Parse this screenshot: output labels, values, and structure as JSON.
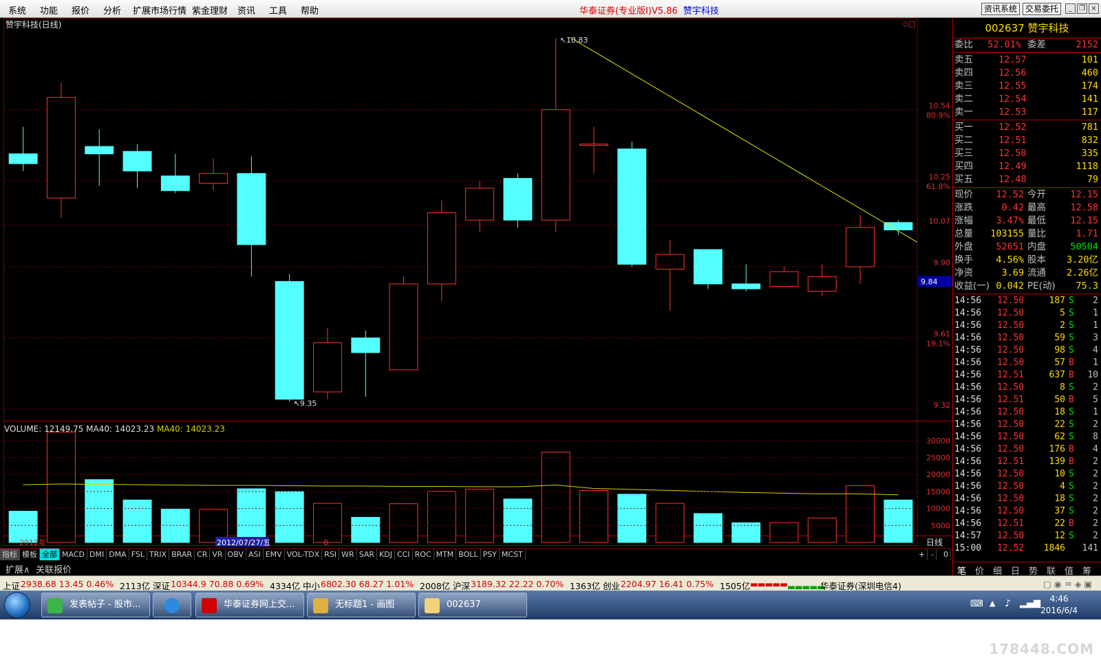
{
  "menu": [
    "系统",
    "功能",
    "报价",
    "分析",
    "扩展市场行情",
    "紫金理财",
    "资讯",
    "工具",
    "帮助"
  ],
  "app_title": "华泰证券(专业版Ⅰ)V5.86",
  "stock_title": "赞宇科技",
  "top_buttons": [
    "资讯系统",
    "交易委托"
  ],
  "window_buttons": [
    "_",
    "❐",
    "×"
  ],
  "chart_title": "赞宇科技(日线)",
  "price_scale": {
    "ticks": [
      "10.54",
      "10.25",
      "10.07",
      "9.90",
      "9.61",
      "9.32"
    ],
    "pcts": [
      "80.9%",
      "61.8%",
      "19.1%"
    ],
    "marker": "9.84"
  },
  "annotations": {
    "high": "10.83",
    "low": "9.35"
  },
  "volume_label": {
    "prefix": "VOLUME: 12149.75  MA40: 14023.23",
    "ma": "MA40: 14023.23"
  },
  "volume_scale": [
    "30000",
    "25000",
    "20000",
    "15000",
    "10000",
    "5000"
  ],
  "date_bar": {
    "year": "2012年",
    "date": "2012/07/27/五",
    "tick": "8",
    "period": "日线"
  },
  "indicator_tabs": [
    "指标",
    "模板",
    "全部",
    "MACD",
    "DMI",
    "DMA",
    "FSL",
    "TRIX",
    "BRAR",
    "CR",
    "VR",
    "OBV",
    "ASI",
    "EMV",
    "VOL-TDX",
    "RSI",
    "WR",
    "SAR",
    "KDJ",
    "CCI",
    "ROC",
    "MTM",
    "BOLL",
    "PSY",
    "MCST"
  ],
  "indicator_right": [
    "+",
    "-",
    "0"
  ],
  "ext_tabs": [
    "扩展∧",
    "关联报价"
  ],
  "colors": {
    "up": "#ff3232",
    "down": "#54ffff",
    "ma": "#d4d400",
    "trend": "#e8e800",
    "grid": "#7a0000",
    "accent": "#ffde00"
  },
  "chart_data": {
    "type": "candlestick",
    "title": "赞宇科技(日线)",
    "ylim": [
      9.32,
      10.83
    ],
    "candles": [
      {
        "o": 10.36,
        "c": 10.32,
        "h": 10.47,
        "l": 10.29,
        "v": 9200
      },
      {
        "o": 10.18,
        "c": 10.59,
        "h": 10.65,
        "l": 10.1,
        "v": 32500
      },
      {
        "o": 10.39,
        "c": 10.36,
        "h": 10.46,
        "l": 10.23,
        "v": 18500
      },
      {
        "o": 10.37,
        "c": 10.29,
        "h": 10.4,
        "l": 10.22,
        "v": 12500
      },
      {
        "o": 10.27,
        "c": 10.21,
        "h": 10.36,
        "l": 10.2,
        "v": 9800
      },
      {
        "o": 10.24,
        "c": 10.28,
        "h": 10.34,
        "l": 10.21,
        "v": 9700
      },
      {
        "o": 10.28,
        "c": 9.99,
        "h": 10.35,
        "l": 9.86,
        "v": 15800
      },
      {
        "o": 9.84,
        "c": 9.36,
        "h": 9.87,
        "l": 9.35,
        "v": 15000
      },
      {
        "o": 9.39,
        "c": 9.59,
        "h": 9.65,
        "l": 9.36,
        "v": 11500
      },
      {
        "o": 9.61,
        "c": 9.55,
        "h": 9.64,
        "l": 9.37,
        "v": 7400
      },
      {
        "o": 9.48,
        "c": 9.83,
        "h": 9.86,
        "l": 9.48,
        "v": 11400
      },
      {
        "o": 9.83,
        "c": 10.12,
        "h": 10.17,
        "l": 9.76,
        "v": 15100
      },
      {
        "o": 10.09,
        "c": 10.22,
        "h": 10.25,
        "l": 10.04,
        "v": 15700
      },
      {
        "o": 10.26,
        "c": 10.09,
        "h": 10.28,
        "l": 10.06,
        "v": 12800
      },
      {
        "o": 10.09,
        "c": 10.54,
        "h": 10.83,
        "l": 10.04,
        "v": 26600
      },
      {
        "o": 10.4,
        "c": 10.4,
        "h": 10.47,
        "l": 10.28,
        "v": 15300
      },
      {
        "o": 10.38,
        "c": 9.91,
        "h": 10.41,
        "l": 9.9,
        "v": 14200
      },
      {
        "o": 9.89,
        "c": 9.95,
        "h": 10.01,
        "l": 9.72,
        "v": 11500
      },
      {
        "o": 9.97,
        "c": 9.83,
        "h": 9.97,
        "l": 9.81,
        "v": 8500
      },
      {
        "o": 9.83,
        "c": 9.81,
        "h": 9.91,
        "l": 9.8,
        "v": 5800
      },
      {
        "o": 9.82,
        "c": 9.88,
        "h": 9.9,
        "l": 9.82,
        "v": 5800
      },
      {
        "o": 9.8,
        "c": 9.86,
        "h": 9.91,
        "l": 9.78,
        "v": 7200
      },
      {
        "o": 9.9,
        "c": 10.06,
        "h": 10.11,
        "l": 9.83,
        "v": 16700
      },
      {
        "o": 10.08,
        "c": 10.05,
        "h": 10.09,
        "l": 10.03,
        "v": 12500
      }
    ],
    "ma40": [
      17000,
      17200,
      17100,
      17000,
      16900,
      16800,
      16800,
      16700,
      16600,
      16600,
      16500,
      16500,
      16400,
      16400,
      16900,
      15900,
      15600,
      15300,
      15000,
      14700,
      14500,
      14300,
      14300,
      14000
    ],
    "volume_ylim": [
      0,
      33000
    ],
    "volume_ticks": [
      5000,
      10000,
      15000,
      20000,
      25000,
      30000
    ]
  },
  "quote": {
    "code": "002637",
    "name": "赞宇科技",
    "wb": {
      "l1": "委比",
      "v1": "52.01%",
      "l2": "委差",
      "v2": "2152"
    },
    "asks": [
      {
        "l": "卖五",
        "p": "12.57",
        "q": "101"
      },
      {
        "l": "卖四",
        "p": "12.56",
        "q": "460"
      },
      {
        "l": "卖三",
        "p": "12.55",
        "q": "174"
      },
      {
        "l": "卖二",
        "p": "12.54",
        "q": "141"
      },
      {
        "l": "卖一",
        "p": "12.53",
        "q": "117"
      }
    ],
    "bids": [
      {
        "l": "买一",
        "p": "12.52",
        "q": "781"
      },
      {
        "l": "买二",
        "p": "12.51",
        "q": "832"
      },
      {
        "l": "买三",
        "p": "12.50",
        "q": "335"
      },
      {
        "l": "买四",
        "p": "12.49",
        "q": "1118"
      },
      {
        "l": "买五",
        "p": "12.48",
        "q": "79"
      }
    ],
    "stats": [
      {
        "l1": "现价",
        "v1": "12.52",
        "l2": "今开",
        "v2": "12.15",
        "c1": "#ff3232",
        "c2": "#ff3232"
      },
      {
        "l1": "涨跌",
        "v1": "0.42",
        "l2": "最高",
        "v2": "12.58",
        "c1": "#ff3232",
        "c2": "#ff3232"
      },
      {
        "l1": "涨幅",
        "v1": "3.47%",
        "l2": "最低",
        "v2": "12.15",
        "c1": "#ff3232",
        "c2": "#ff3232"
      },
      {
        "l1": "总量",
        "v1": "103155",
        "l2": "量比",
        "v2": "1.71",
        "c1": "#ffde00",
        "c2": "#ff3232"
      },
      {
        "l1": "外盘",
        "v1": "52651",
        "l2": "内盘",
        "v2": "50504",
        "c1": "#ff3232",
        "c2": "#00e000"
      },
      {
        "l1": "换手",
        "v1": "4.56%",
        "l2": "股本",
        "v2": "3.20亿",
        "c1": "#ffde00",
        "c2": "#ffde00"
      },
      {
        "l1": "净资",
        "v1": "3.69",
        "l2": "流通",
        "v2": "2.26亿",
        "c1": "#ffde00",
        "c2": "#ffde00"
      },
      {
        "l1": "收益(一)",
        "v1": "0.042",
        "l2": "PE(动)",
        "v2": "75.3",
        "c1": "#ffde00",
        "c2": "#ffde00"
      }
    ],
    "ticks": [
      {
        "t": "14:56",
        "p": "12.50",
        "v": "187",
        "s": "S",
        "n": "2"
      },
      {
        "t": "14:56",
        "p": "12.50",
        "v": "5",
        "s": "S",
        "n": "1"
      },
      {
        "t": "14:56",
        "p": "12.50",
        "v": "2",
        "s": "S",
        "n": "1"
      },
      {
        "t": "14:56",
        "p": "12.50",
        "v": "59",
        "s": "S",
        "n": "3"
      },
      {
        "t": "14:56",
        "p": "12.50",
        "v": "98",
        "s": "S",
        "n": "4"
      },
      {
        "t": "14:56",
        "p": "12.50",
        "v": "57",
        "s": "B",
        "n": "1"
      },
      {
        "t": "14:56",
        "p": "12.51",
        "v": "637",
        "s": "B",
        "n": "10"
      },
      {
        "t": "14:56",
        "p": "12.50",
        "v": "8",
        "s": "S",
        "n": "2"
      },
      {
        "t": "14:56",
        "p": "12.51",
        "v": "50",
        "s": "B",
        "n": "5"
      },
      {
        "t": "14:56",
        "p": "12.50",
        "v": "18",
        "s": "S",
        "n": "1"
      },
      {
        "t": "14:56",
        "p": "12.50",
        "v": "22",
        "s": "S",
        "n": "2"
      },
      {
        "t": "14:56",
        "p": "12.50",
        "v": "62",
        "s": "S",
        "n": "8"
      },
      {
        "t": "14:56",
        "p": "12.50",
        "v": "176",
        "s": "B",
        "n": "4"
      },
      {
        "t": "14:56",
        "p": "12.51",
        "v": "139",
        "s": "B",
        "n": "2"
      },
      {
        "t": "14:56",
        "p": "12.50",
        "v": "10",
        "s": "S",
        "n": "2"
      },
      {
        "t": "14:56",
        "p": "12.50",
        "v": "4",
        "s": "S",
        "n": "2"
      },
      {
        "t": "14:56",
        "p": "12.50",
        "v": "18",
        "s": "S",
        "n": "2"
      },
      {
        "t": "14:56",
        "p": "12.50",
        "v": "37",
        "s": "S",
        "n": "2"
      },
      {
        "t": "14:56",
        "p": "12.51",
        "v": "22",
        "s": "B",
        "n": "2"
      },
      {
        "t": "14:57",
        "p": "12.50",
        "v": "12",
        "s": "S",
        "n": "2"
      },
      {
        "t": "15:00",
        "p": "12.52",
        "v": "1846",
        "s": "",
        "n": "141"
      }
    ],
    "side_tabs": [
      "笔",
      "价",
      "细",
      "日",
      "势",
      "联",
      "值",
      "筹"
    ]
  },
  "status": [
    {
      "lab": "上证",
      "vals": "2938.68  13.45  0.46%",
      "amt": "2113亿"
    },
    {
      "lab": "深证",
      "vals": "10344.9  70.88  0.69%",
      "amt": "4334亿"
    },
    {
      "lab": "中小",
      "vals": "6802.30  68.27  1.01%",
      "amt": "2008亿"
    },
    {
      "lab": "沪深",
      "vals": "3189.32  22.22  0.70%",
      "amt": "1363亿"
    },
    {
      "lab": "创业",
      "vals": "2204.97  16.41  0.75%",
      "amt": "1505亿"
    }
  ],
  "broker": "华泰证券(深圳电信4)",
  "taskbar": {
    "items": [
      "发表帖子 - 股市...",
      "",
      "华泰证券网上交...",
      "无标题1 - 画图",
      "002637"
    ],
    "time": "4:46",
    "date": "2016/6/4"
  },
  "watermark": "178448.COM"
}
